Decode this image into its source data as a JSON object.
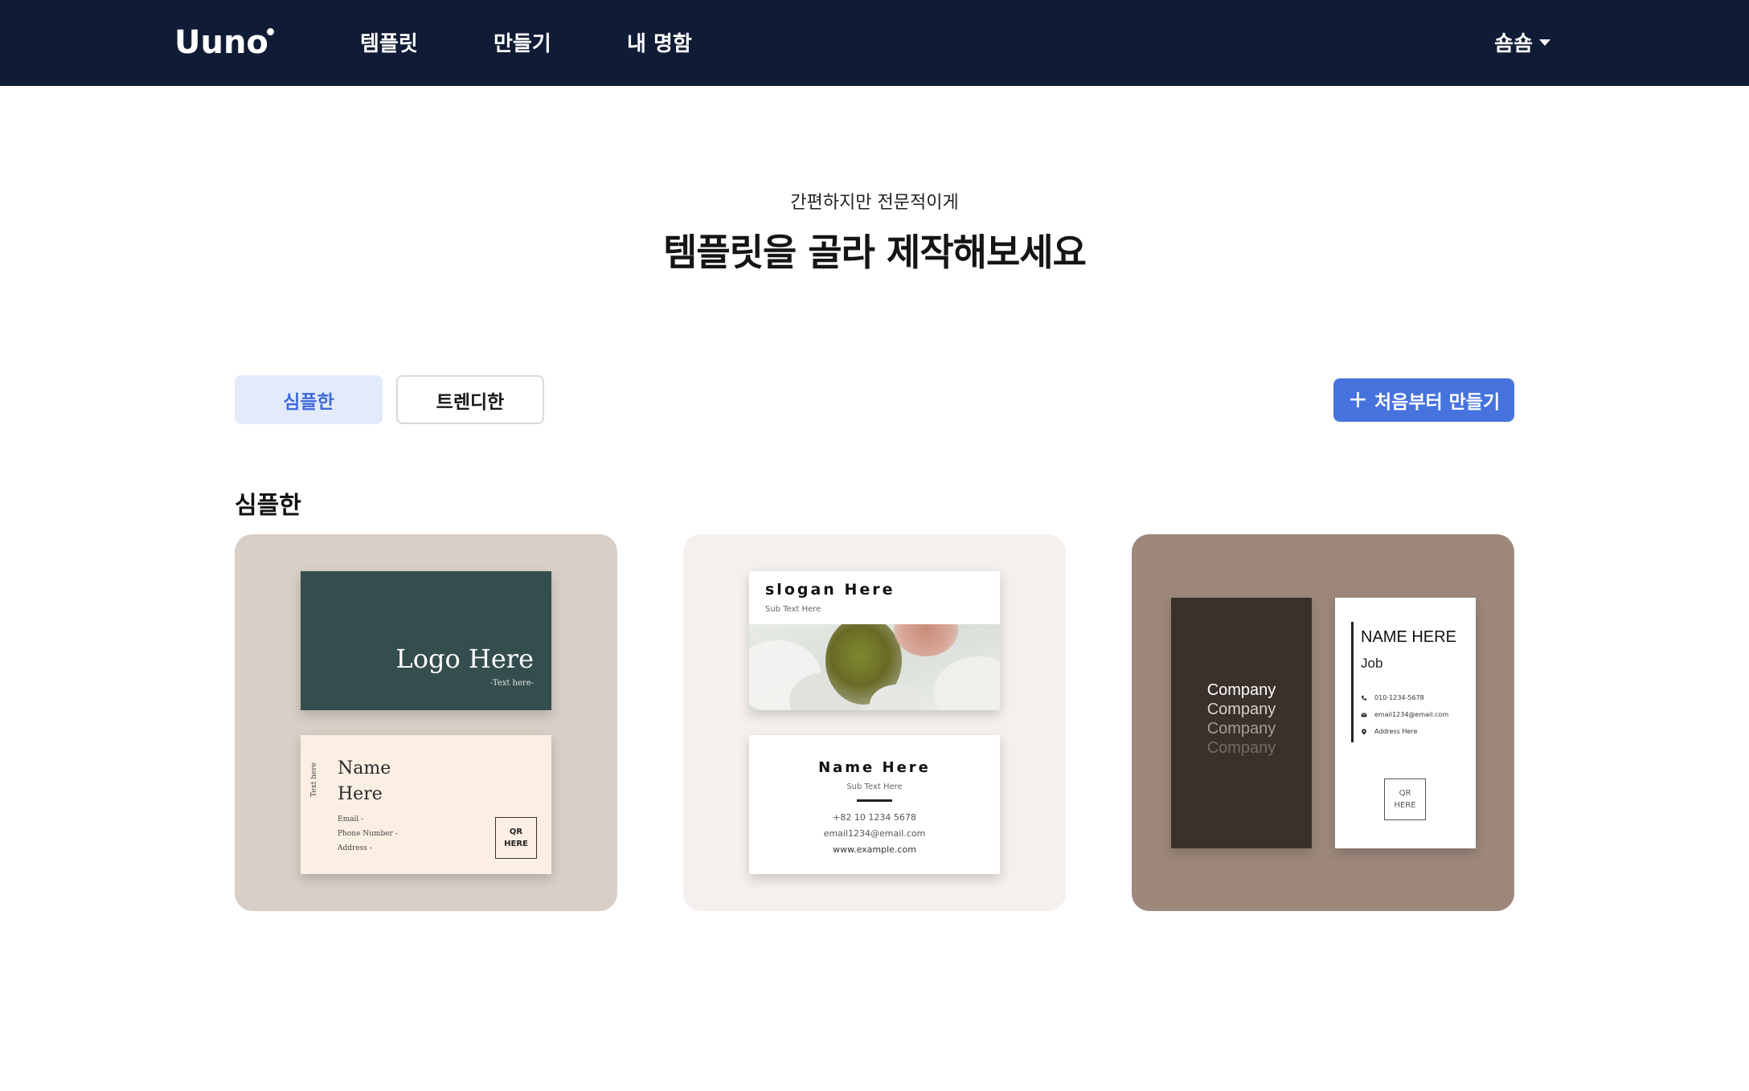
{
  "header": {
    "logo": "Uuno",
    "nav": [
      {
        "label": "템플릿"
      },
      {
        "label": "만들기"
      },
      {
        "label": "내 명함"
      }
    ],
    "user": "숌숌"
  },
  "hero": {
    "subtitle": "간편하지만 전문적이게",
    "title": "템플릿을 골라 제작해보세요"
  },
  "filters": {
    "active": "심플한",
    "other": "트렌디한"
  },
  "new_button": {
    "label": "처음부터 만들기",
    "icon": "plus-icon"
  },
  "section": {
    "title": "심플한"
  },
  "templates": [
    {
      "front": {
        "logo": "Logo Here",
        "sub": "-Text here-"
      },
      "back": {
        "side_text": "Text here",
        "name": [
          "Name",
          "Here"
        ],
        "info": [
          "Email -",
          "Phone Number -",
          "Address -"
        ],
        "qr": [
          "QR",
          "HERE"
        ]
      }
    },
    {
      "front": {
        "slogan": "slogan Here",
        "sub": "Sub Text Here"
      },
      "back": {
        "name": "Name Here",
        "sub": "Sub Text Here",
        "lines": [
          "+82 10 1234 5678",
          "email1234@email.com",
          "www.example.com"
        ]
      }
    },
    {
      "left": {
        "company": [
          "Company",
          "Company",
          "Company",
          "Company"
        ]
      },
      "right": {
        "name": "NAME HERE",
        "job": "Job",
        "rows": [
          {
            "icon": "phone-icon",
            "text": "010-1234-5678"
          },
          {
            "icon": "mail-icon",
            "text": "email1234@email.com"
          },
          {
            "icon": "location-pin-icon",
            "text": "Address Here"
          }
        ],
        "qr": [
          "QR",
          "HERE"
        ]
      }
    }
  ],
  "colors": {
    "header_bg": "#101b35",
    "accent": "#4673de",
    "filter_active_bg": "#e3ebfa",
    "card1_bg": "#d9cfc7",
    "card2_bg": "#f5f0ed",
    "card3_bg": "#9d887b"
  }
}
